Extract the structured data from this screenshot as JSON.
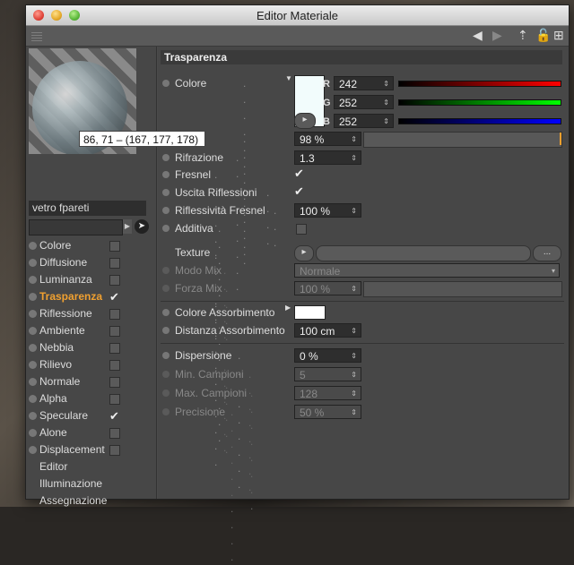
{
  "window": {
    "title": "Editor Materiale"
  },
  "tooltip": "86, 71 – (167, 177, 178)",
  "material": {
    "name": "vetro fpareti"
  },
  "channels": [
    {
      "label": "Colore",
      "checked": false
    },
    {
      "label": "Diffusione",
      "checked": false
    },
    {
      "label": "Luminanza",
      "checked": false
    },
    {
      "label": "Trasparenza",
      "checked": true,
      "active": true
    },
    {
      "label": "Riflessione",
      "checked": false
    },
    {
      "label": "Ambiente",
      "checked": false
    },
    {
      "label": "Nebbia",
      "checked": false
    },
    {
      "label": "Rilievo",
      "checked": false
    },
    {
      "label": "Normale",
      "checked": false
    },
    {
      "label": "Alpha",
      "checked": false
    },
    {
      "label": "Speculare",
      "checked": true
    },
    {
      "label": "Alone",
      "checked": false
    },
    {
      "label": "Displacement",
      "checked": false
    }
  ],
  "extra_items": [
    "Editor",
    "Illuminazione",
    "Assegnazione"
  ],
  "section": {
    "title": "Trasparenza"
  },
  "colore": {
    "label": "Colore",
    "swatch": "#f2fcfc",
    "r_label": "R",
    "g_label": "G",
    "b_label": "B",
    "r": "242",
    "g": "252",
    "b": "252"
  },
  "luminosita": {
    "value": "98 %"
  },
  "rifrazione": {
    "label": "Rifrazione",
    "value": "1.3"
  },
  "fresnel": {
    "label": "Fresnel",
    "checked": true
  },
  "uscita": {
    "label": "Uscita Riflessioni",
    "checked": true
  },
  "riflessivita": {
    "label": "Riflessività Fresnel",
    "value": "100 %"
  },
  "additiva": {
    "label": "Additiva",
    "checked": false
  },
  "texture": {
    "label": "Texture",
    "more_label": "..."
  },
  "modomix": {
    "label": "Modo Mix",
    "value": "Normale"
  },
  "forzamix": {
    "label": "Forza Mix",
    "value": "100 %"
  },
  "colore_assorb": {
    "label": "Colore Assorbimento",
    "swatch": "#ffffff"
  },
  "dist_assorb": {
    "label": "Distanza Assorbimento",
    "value": "100 cm"
  },
  "dispersione": {
    "label": "Dispersione",
    "value": "0 %"
  },
  "min_camp": {
    "label": "Min. Campioni",
    "value": "5"
  },
  "max_camp": {
    "label": "Max. Campioni",
    "value": "128"
  },
  "precisione": {
    "label": "Precisione",
    "value": "50 %"
  },
  "colors": {
    "active": "#f0a030",
    "panel": "#474747",
    "field": "#2e2e2e"
  }
}
